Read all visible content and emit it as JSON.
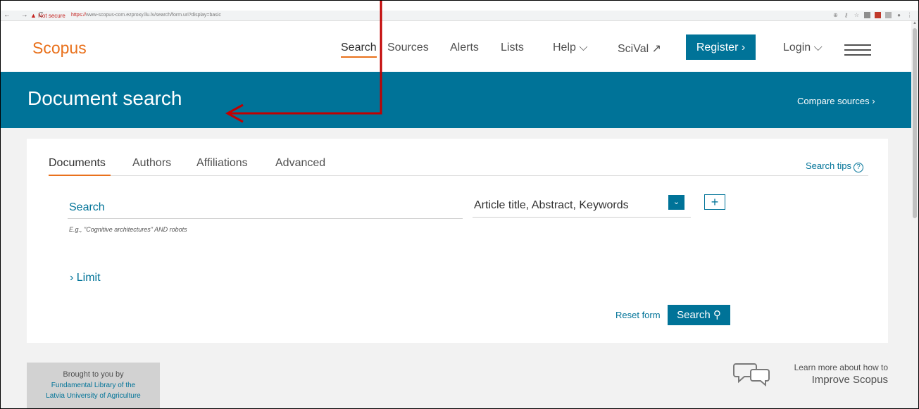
{
  "browser": {
    "nav_glyphs": "← → C",
    "security": "Not secure",
    "url_proto": "https://",
    "url_rest": "www-scopus-com.ezproxy.llu.lv/search/form.uri?display=basic"
  },
  "header": {
    "logo": "Scopus",
    "nav": [
      "Search",
      "Sources",
      "Alerts",
      "Lists",
      "Help ⌵",
      "SciVal ↗"
    ],
    "register": "Register ›",
    "login": "Login ⌵"
  },
  "banner": {
    "title": "Document search",
    "compare": "Compare sources ›"
  },
  "tabs": [
    "Documents",
    "Authors",
    "Affiliations",
    "Advanced"
  ],
  "search_tips": "Search tips",
  "search_tips_icon": "?",
  "search": {
    "placeholder": "Search",
    "example": "E.g., \"Cognitive architectures\" AND robots",
    "field": "Article title, Abstract, Keywords",
    "dropdown_glyph": "⌄",
    "add_glyph": "+"
  },
  "limit": "› Limit",
  "reset": "Reset form",
  "search_button": "Search ⚲",
  "footer": {
    "brought_by": "Brought to you by",
    "library_line1": "Fundamental Library of the",
    "library_line2": "Latvia University of Agriculture",
    "learn_line1": "Learn more about how to",
    "learn_line2": "Improve Scopus"
  },
  "colors": {
    "brand_orange": "#e9711c",
    "brand_blue": "#007398",
    "annotation": "#c00000"
  }
}
